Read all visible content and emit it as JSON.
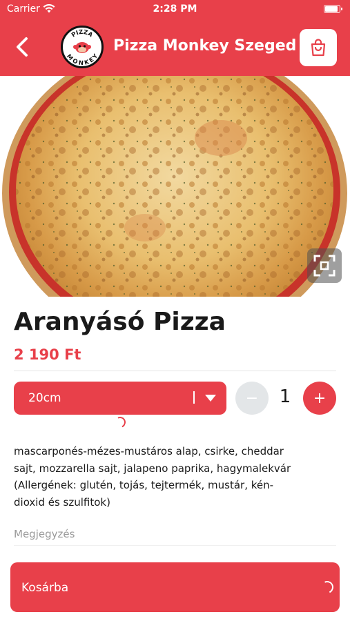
{
  "status_bar": {
    "carrier": "Carrier",
    "time": "2:28 PM"
  },
  "header": {
    "title": "Pizza Monkey Szeged",
    "logo_text_top": "PIZZA",
    "logo_text_bottom": "MONKEY"
  },
  "product": {
    "name": "Aranyásó Pizza",
    "price": "2 190 Ft",
    "size_selected": "20cm",
    "quantity": "1",
    "minus_label": "−",
    "plus_label": "+",
    "description": "mascarponés-mézes-mustáros alap, csirke, cheddar sajt, mozzarella sajt, jalapeno paprika, hagymalekvár (Allergének: glutén, tojás, tejtermék, mustár, kén-dioxid és szulfitok)",
    "note_placeholder": "Megjegyzés"
  },
  "actions": {
    "add_to_cart": "Kosárba"
  },
  "colors": {
    "brand": "#e8404a",
    "disabled": "#e3e6e8"
  },
  "icons": [
    "wifi-icon",
    "battery-icon",
    "back-chevron-icon",
    "shopping-bag-icon",
    "expand-icon",
    "chevron-down-icon",
    "loading-spinner-icon"
  ]
}
